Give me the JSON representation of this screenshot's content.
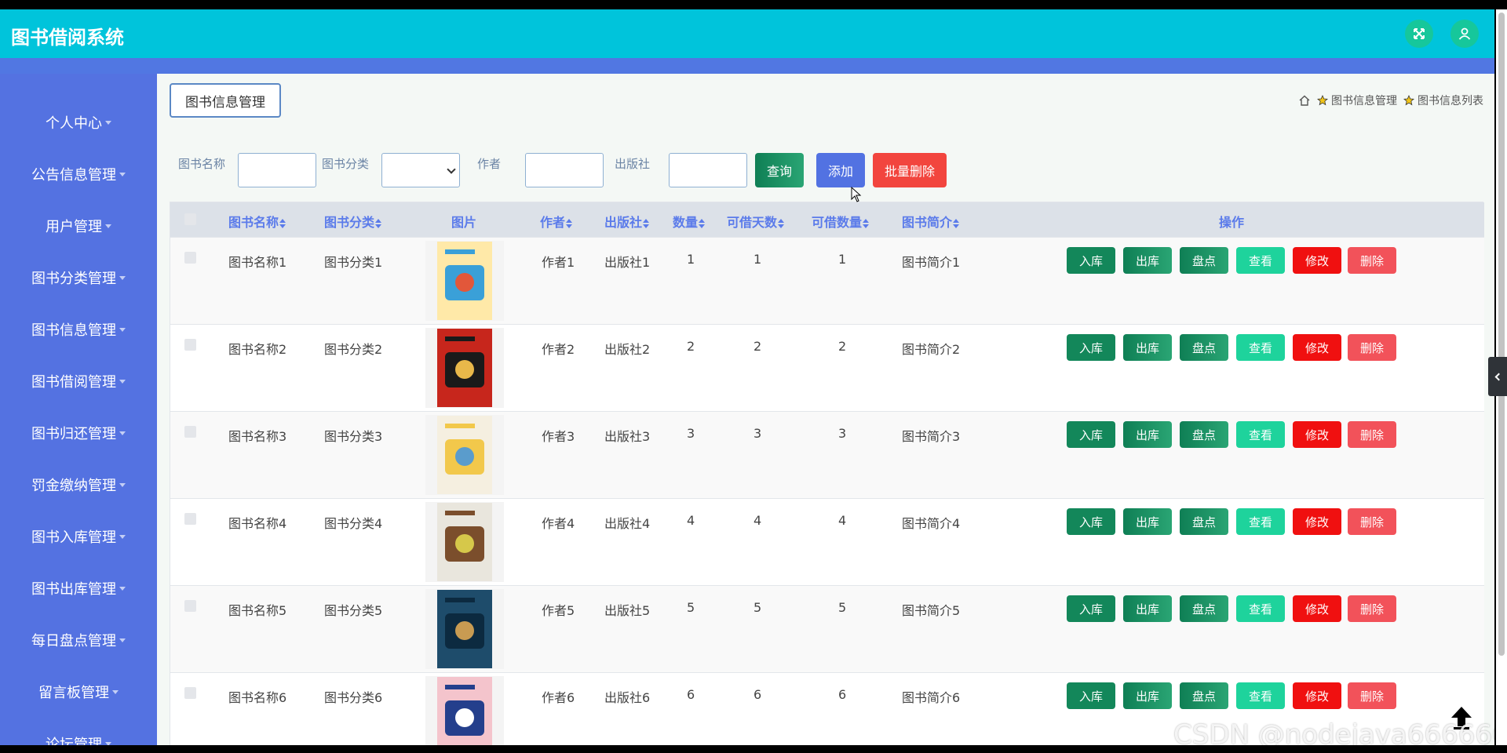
{
  "app": {
    "title": "图书借阅系统"
  },
  "sidebar": {
    "items": [
      {
        "label": "个人中心"
      },
      {
        "label": "公告信息管理"
      },
      {
        "label": "用户管理"
      },
      {
        "label": "图书分类管理"
      },
      {
        "label": "图书信息管理"
      },
      {
        "label": "图书借阅管理"
      },
      {
        "label": "图书归还管理"
      },
      {
        "label": "罚金缴纳管理"
      },
      {
        "label": "图书入库管理"
      },
      {
        "label": "图书出库管理"
      },
      {
        "label": "每日盘点管理"
      },
      {
        "label": "留言板管理"
      },
      {
        "label": "论坛管理"
      }
    ]
  },
  "page": {
    "tab_label": "图书信息管理",
    "breadcrumb": [
      "图书信息管理",
      "图书信息列表"
    ]
  },
  "search": {
    "name_label": "图书名称",
    "category_label": "图书分类",
    "author_label": "作者",
    "publisher_label": "出版社",
    "name_value": "",
    "category_value": "",
    "author_value": "",
    "publisher_value": "",
    "query_label": "查询",
    "add_label": "添加",
    "batch_delete_label": "批量删除"
  },
  "table": {
    "headers": {
      "name": "图书名称",
      "category": "图书分类",
      "image": "图片",
      "author": "作者",
      "publisher": "出版社",
      "quantity": "数量",
      "borrow_days": "可借天数",
      "borrow_qty": "可借数量",
      "intro": "图书简介",
      "actions": "操作"
    },
    "action_labels": {
      "in": "入库",
      "out": "出库",
      "check": "盘点",
      "view": "查看",
      "edit": "修改",
      "del": "删除"
    },
    "rows": [
      {
        "name": "图书名称1",
        "category": "图书分类1",
        "author": "作者1",
        "publisher": "出版社1",
        "quantity": "1",
        "borrow_days": "1",
        "borrow_qty": "1",
        "intro": "图书简介1"
      },
      {
        "name": "图书名称2",
        "category": "图书分类2",
        "author": "作者2",
        "publisher": "出版社2",
        "quantity": "2",
        "borrow_days": "2",
        "borrow_qty": "2",
        "intro": "图书简介2"
      },
      {
        "name": "图书名称3",
        "category": "图书分类3",
        "author": "作者3",
        "publisher": "出版社3",
        "quantity": "3",
        "borrow_days": "3",
        "borrow_qty": "3",
        "intro": "图书简介3"
      },
      {
        "name": "图书名称4",
        "category": "图书分类4",
        "author": "作者4",
        "publisher": "出版社4",
        "quantity": "4",
        "borrow_days": "4",
        "borrow_qty": "4",
        "intro": "图书简介4"
      },
      {
        "name": "图书名称5",
        "category": "图书分类5",
        "author": "作者5",
        "publisher": "出版社5",
        "quantity": "5",
        "borrow_days": "5",
        "borrow_qty": "5",
        "intro": "图书简介5"
      },
      {
        "name": "图书名称6",
        "category": "图书分类6",
        "author": "作者6",
        "publisher": "出版社6",
        "quantity": "6",
        "borrow_days": "6",
        "borrow_qty": "6",
        "intro": "图书简介6"
      }
    ]
  },
  "watermark": "CSDN @nodejava666666",
  "colors": {
    "topbar": "#00c4db",
    "sidebar": "#5472e1",
    "header_text": "#5b7bea",
    "edit": "#f01010",
    "delete": "#f2525a",
    "view": "#1ed39c"
  },
  "icons": [
    "fullscreen-icon",
    "user-icon",
    "home-icon",
    "star-icon",
    "sort-icon",
    "back-to-top-icon",
    "collapse-chevron-icon"
  ]
}
